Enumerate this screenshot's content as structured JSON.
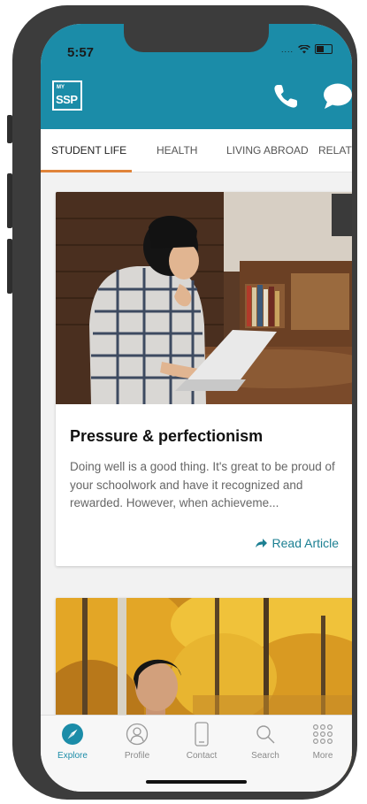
{
  "status_bar": {
    "time": "5:57",
    "signal": "....",
    "wifi_icon": "wifi-icon",
    "battery_icon": "battery-icon"
  },
  "header": {
    "logo_small": "MY",
    "logo_main": "SSP",
    "phone_icon": "phone-icon",
    "chat_icon": "chat-bubble-icon",
    "color": "#1b8ca8"
  },
  "tabs": [
    {
      "label": "STUDENT LIFE",
      "active": true
    },
    {
      "label": "HEALTH",
      "active": false
    },
    {
      "label": "LIVING ABROAD",
      "active": false
    },
    {
      "label": "RELATION",
      "active": false
    }
  ],
  "tab_indicator_color": "#e0843a",
  "articles": [
    {
      "title": "Pressure & perfectionism",
      "excerpt": "Doing well is a good thing. It's great to be proud of your schoolwork and have it recognized and rewarded. However, when achieveme...",
      "link_label": "Read Article",
      "link_icon": "share-arrow-icon"
    }
  ],
  "bottom_nav": [
    {
      "label": "Explore",
      "icon": "compass-icon",
      "active": true
    },
    {
      "label": "Profile",
      "icon": "profile-icon",
      "active": false
    },
    {
      "label": "Contact",
      "icon": "phone-device-icon",
      "active": false
    },
    {
      "label": "Search",
      "icon": "search-icon",
      "active": false
    },
    {
      "label": "More",
      "icon": "grid-dots-icon",
      "active": false
    }
  ],
  "accent_color": "#1b7f92"
}
